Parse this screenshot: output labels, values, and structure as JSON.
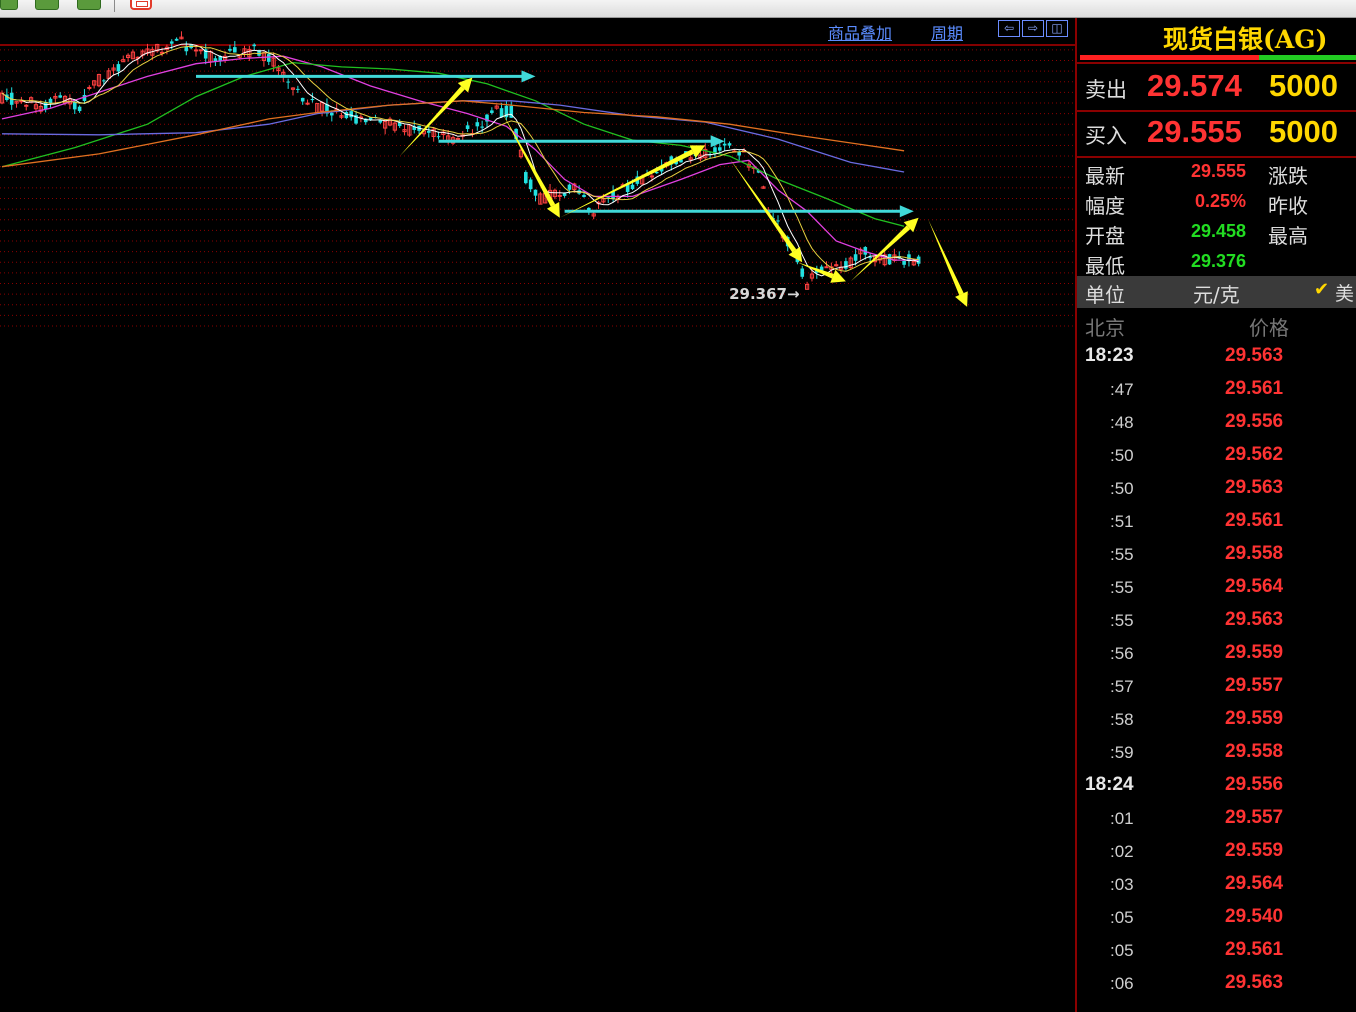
{
  "chart_header": {
    "overlay_label": "商品叠加",
    "period_label": "周期",
    "nav_icons": [
      "arrow-left-icon",
      "arrow-right-icon",
      "split-view-icon"
    ]
  },
  "panel": {
    "title": "现货白银(AG)",
    "ratio_red_fraction": 0.65,
    "sell": {
      "label": "卖出",
      "price": "29.574",
      "volume": "5000"
    },
    "buy": {
      "label": "买入",
      "price": "29.555",
      "volume": "5000"
    },
    "stats": [
      {
        "label": "最新",
        "value": "29.555",
        "color": "#ff3333",
        "label2": "涨跌"
      },
      {
        "label": "幅度",
        "value": "0.25%",
        "color": "#ff3333",
        "label2": "昨收"
      },
      {
        "label": "开盘",
        "value": "29.458",
        "color": "#22dd22",
        "label2": "最高"
      },
      {
        "label": "最低",
        "value": "29.376",
        "color": "#22dd22",
        "label2": ""
      }
    ],
    "unit": {
      "label": "单位",
      "value": "元/克",
      "check_icon": "checkmark-icon",
      "extra": "美"
    },
    "ticks_header": {
      "time": "北京",
      "price": "价格"
    },
    "ticks": [
      {
        "time": "18:23",
        "major": true,
        "price": "29.563"
      },
      {
        "time": ":47",
        "major": false,
        "price": "29.561"
      },
      {
        "time": ":48",
        "major": false,
        "price": "29.556"
      },
      {
        "time": ":50",
        "major": false,
        "price": "29.562"
      },
      {
        "time": ":50",
        "major": false,
        "price": "29.563"
      },
      {
        "time": ":51",
        "major": false,
        "price": "29.561"
      },
      {
        "time": ":55",
        "major": false,
        "price": "29.558"
      },
      {
        "time": ":55",
        "major": false,
        "price": "29.564"
      },
      {
        "time": ":55",
        "major": false,
        "price": "29.563"
      },
      {
        "time": ":56",
        "major": false,
        "price": "29.559"
      },
      {
        "time": ":57",
        "major": false,
        "price": "29.557"
      },
      {
        "time": ":58",
        "major": false,
        "price": "29.559"
      },
      {
        "time": ":59",
        "major": false,
        "price": "29.558"
      },
      {
        "time": "18:24",
        "major": true,
        "price": "29.556"
      },
      {
        "time": ":01",
        "major": false,
        "price": "29.557"
      },
      {
        "time": ":02",
        "major": false,
        "price": "29.559"
      },
      {
        "time": ":03",
        "major": false,
        "price": "29.564"
      },
      {
        "time": ":05",
        "major": false,
        "price": "29.540"
      },
      {
        "time": ":05",
        "major": false,
        "price": "29.561"
      },
      {
        "time": ":06",
        "major": false,
        "price": "29.563"
      }
    ]
  },
  "chart_data": {
    "type": "candlestick",
    "bar_count": 190,
    "ylim": [
      29.34,
      29.63
    ],
    "grid": "horizontal-dotted",
    "low_marker": {
      "bar": 166,
      "value": "29.367"
    },
    "colors": {
      "up": "#ff4040",
      "down": "#22e0e0",
      "ma5": "#ffffff",
      "ma10": "#e6d040",
      "ma20": "#e040e0",
      "ma60": "#20c020",
      "ma120": "#6a6ae0",
      "ma250": "#e07020",
      "arrow": "#ffff22",
      "level": "#40d8d8",
      "grid": "#8b0000"
    },
    "anchors": [
      [
        0,
        29.556
      ],
      [
        8,
        29.548
      ],
      [
        12,
        29.555
      ],
      [
        16,
        29.548
      ],
      [
        20,
        29.572
      ],
      [
        24,
        29.585
      ],
      [
        28,
        29.595
      ],
      [
        32,
        29.6
      ],
      [
        36,
        29.608
      ],
      [
        40,
        29.6
      ],
      [
        44,
        29.59
      ],
      [
        48,
        29.597
      ],
      [
        52,
        29.6
      ],
      [
        56,
        29.588
      ],
      [
        60,
        29.566
      ],
      [
        64,
        29.548
      ],
      [
        70,
        29.538
      ],
      [
        76,
        29.533
      ],
      [
        82,
        29.528
      ],
      [
        87,
        29.522
      ],
      [
        92,
        29.516
      ],
      [
        97,
        29.526
      ],
      [
        102,
        29.542
      ],
      [
        105,
        29.542
      ],
      [
        108,
        29.48
      ],
      [
        111,
        29.46
      ],
      [
        114,
        29.465
      ],
      [
        118,
        29.468
      ],
      [
        122,
        29.448
      ],
      [
        126,
        29.462
      ],
      [
        132,
        29.478
      ],
      [
        138,
        29.496
      ],
      [
        145,
        29.504
      ],
      [
        150,
        29.508
      ],
      [
        153,
        29.5
      ],
      [
        156,
        29.482
      ],
      [
        158,
        29.448
      ],
      [
        161,
        29.428
      ],
      [
        164,
        29.4
      ],
      [
        166,
        29.38
      ],
      [
        169,
        29.392
      ],
      [
        172,
        29.397
      ],
      [
        175,
        29.4
      ],
      [
        178,
        29.41
      ],
      [
        181,
        29.404
      ],
      [
        184,
        29.402
      ],
      [
        189,
        29.402
      ]
    ],
    "moving_averages": [
      {
        "name": "ma20",
        "points": [
          [
            0,
            29.535
          ],
          [
            10,
            29.545
          ],
          [
            20,
            29.56
          ],
          [
            30,
            29.575
          ],
          [
            40,
            29.587
          ],
          [
            50,
            29.592
          ],
          [
            58,
            29.594
          ],
          [
            66,
            29.584
          ],
          [
            76,
            29.566
          ],
          [
            86,
            29.552
          ],
          [
            96,
            29.54
          ],
          [
            104,
            29.528
          ],
          [
            110,
            29.506
          ],
          [
            116,
            29.478
          ],
          [
            122,
            29.462
          ],
          [
            130,
            29.462
          ],
          [
            140,
            29.478
          ],
          [
            148,
            29.492
          ],
          [
            154,
            29.496
          ],
          [
            160,
            29.468
          ],
          [
            166,
            29.448
          ],
          [
            172,
            29.42
          ],
          [
            178,
            29.41
          ],
          [
            184,
            29.402
          ],
          [
            189,
            29.402
          ]
        ]
      },
      {
        "name": "ma60",
        "points": [
          [
            0,
            29.49
          ],
          [
            15,
            29.508
          ],
          [
            30,
            29.53
          ],
          [
            40,
            29.556
          ],
          [
            50,
            29.575
          ],
          [
            60,
            29.588
          ],
          [
            70,
            29.584
          ],
          [
            80,
            29.582
          ],
          [
            90,
            29.578
          ],
          [
            100,
            29.568
          ],
          [
            110,
            29.552
          ],
          [
            120,
            29.53
          ],
          [
            130,
            29.515
          ],
          [
            140,
            29.51
          ],
          [
            150,
            29.5
          ],
          [
            160,
            29.478
          ],
          [
            170,
            29.46
          ],
          [
            180,
            29.441
          ],
          [
            186,
            29.434
          ]
        ]
      },
      {
        "name": "ma120",
        "points": [
          [
            0,
            29.521
          ],
          [
            20,
            29.52
          ],
          [
            40,
            29.522
          ],
          [
            55,
            29.53
          ],
          [
            65,
            29.54
          ],
          [
            80,
            29.548
          ],
          [
            95,
            29.552
          ],
          [
            105,
            29.552
          ],
          [
            115,
            29.548
          ],
          [
            130,
            29.538
          ],
          [
            145,
            29.532
          ],
          [
            160,
            29.516
          ],
          [
            175,
            29.494
          ],
          [
            186,
            29.485
          ]
        ]
      },
      {
        "name": "ma250",
        "points": [
          [
            0,
            29.49
          ],
          [
            20,
            29.502
          ],
          [
            40,
            29.52
          ],
          [
            55,
            29.535
          ],
          [
            65,
            29.541
          ],
          [
            80,
            29.548
          ],
          [
            95,
            29.552
          ],
          [
            105,
            29.548
          ],
          [
            120,
            29.541
          ],
          [
            135,
            29.537
          ],
          [
            150,
            29.53
          ],
          [
            165,
            29.519
          ],
          [
            180,
            29.509
          ],
          [
            186,
            29.505
          ]
        ]
      }
    ],
    "level_lines": [
      {
        "from": 40,
        "to": 110,
        "value": 29.575
      },
      {
        "from": 90,
        "to": 149,
        "value": 29.514
      },
      {
        "from": 116,
        "to": 188,
        "value": 29.448
      }
    ],
    "trend_arrows": [
      [
        [
          82,
          29.5
        ],
        [
          97,
          29.574
        ]
      ],
      [
        [
          103,
          29.542
        ],
        [
          115,
          29.442
        ]
      ],
      [
        [
          115,
          29.442
        ],
        [
          145,
          29.51
        ]
      ],
      [
        [
          150,
          29.498
        ],
        [
          165,
          29.4
        ]
      ],
      [
        [
          164,
          29.4
        ],
        [
          174,
          29.382
        ]
      ],
      [
        [
          175,
          29.382
        ],
        [
          189,
          29.442
        ]
      ],
      [
        [
          191,
          29.44
        ],
        [
          199,
          29.358
        ]
      ]
    ]
  }
}
